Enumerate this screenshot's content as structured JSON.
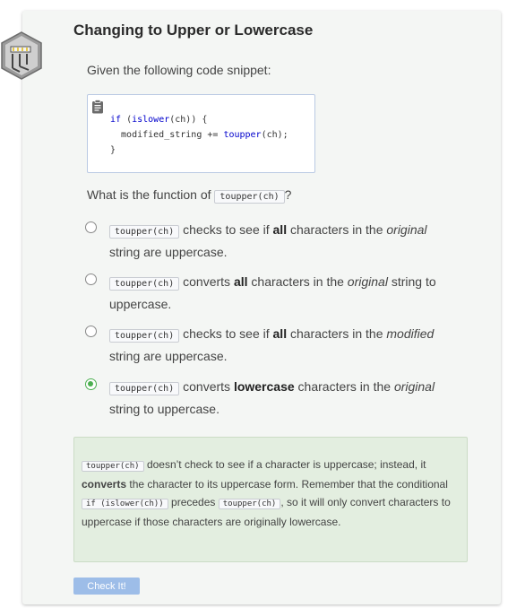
{
  "header": {
    "title": "Changing to Upper or Lowercase"
  },
  "prompt": "Given the following code snippet:",
  "code": {
    "line1_kw": "if",
    "line1_rest_a": " (",
    "line1_fn": "islower",
    "line1_rest_b": "(ch)) {",
    "line2_a": "  modified_string += ",
    "line2_fn": "toupper",
    "line2_b": "(ch);",
    "line3": "}"
  },
  "question": {
    "prefix": "What is the function of ",
    "code": "toupper(ch)",
    "suffix": "?"
  },
  "options": [
    {
      "code": "toupper(ch)",
      "t1": " checks to see if ",
      "b": "all",
      "t2": " characters in the ",
      "i": "original",
      "t3": " string are uppercase.",
      "selected": false
    },
    {
      "code": "toupper(ch)",
      "t1": " converts ",
      "b": "all",
      "t2": " characters in the ",
      "i": "original",
      "t3": " string to uppercase.",
      "selected": false
    },
    {
      "code": "toupper(ch)",
      "t1": " checks to see if ",
      "b": "all",
      "t2": " characters in the ",
      "i": "modified",
      "t3": " string are uppercase.",
      "selected": false
    },
    {
      "code": "toupper(ch)",
      "t1": " converts ",
      "b": "lowercase",
      "t2": " characters in the ",
      "i": "original",
      "t3": " string to uppercase.",
      "selected": true
    }
  ],
  "feedback": {
    "code1": "toupper(ch)",
    "t1": " doesn’t check to see if a character is uppercase; instead, it ",
    "b1": "converts",
    "t2": " the character to its uppercase form. Remember that the conditional ",
    "code2": "if (islower(ch))",
    "t3": " precedes ",
    "code3": "toupper(ch)",
    "t4": ", so it will only convert characters to uppercase if those characters are originally lowercase."
  },
  "check_button": "Check It!",
  "colors": {
    "accent_green": "#4caf50",
    "feedback_bg": "#e3eee0",
    "button_bg": "#9dbde8",
    "keyword_blue": "#0000cc"
  }
}
